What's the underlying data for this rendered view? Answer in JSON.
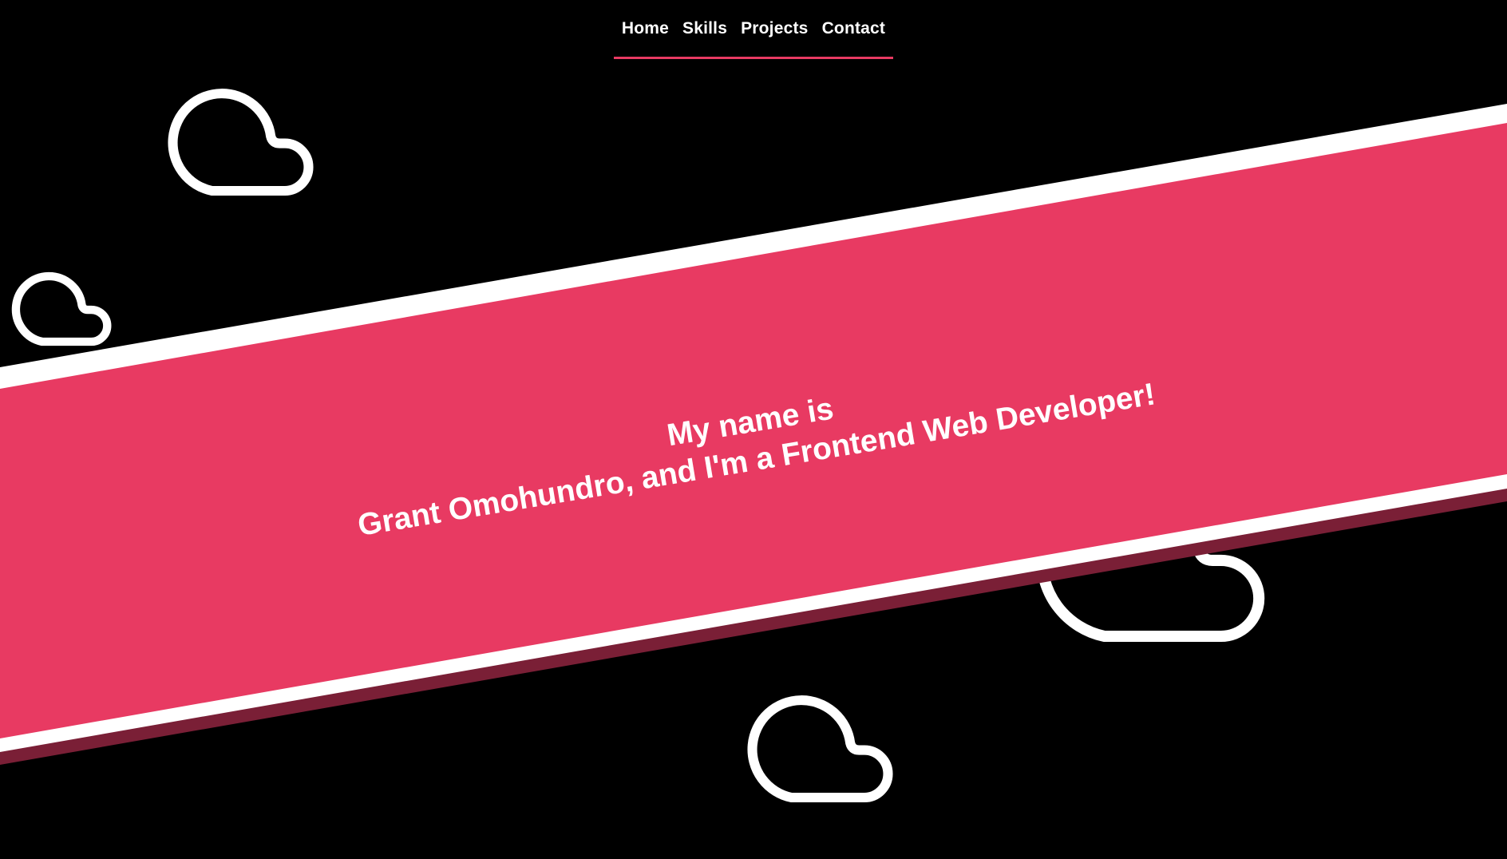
{
  "nav": {
    "items": [
      {
        "label": "Home"
      },
      {
        "label": "Skills"
      },
      {
        "label": "Projects"
      },
      {
        "label": "Contact"
      }
    ]
  },
  "hero": {
    "line1": "My name is",
    "line2": "Grant Omohundro, and I'm a Frontend Web Developer!"
  },
  "colors": {
    "background": "#000000",
    "accent": "#e83a62",
    "accent_shadow": "#7a1f36",
    "foreground": "#ffffff"
  },
  "icons": [
    "cloud-icon"
  ]
}
